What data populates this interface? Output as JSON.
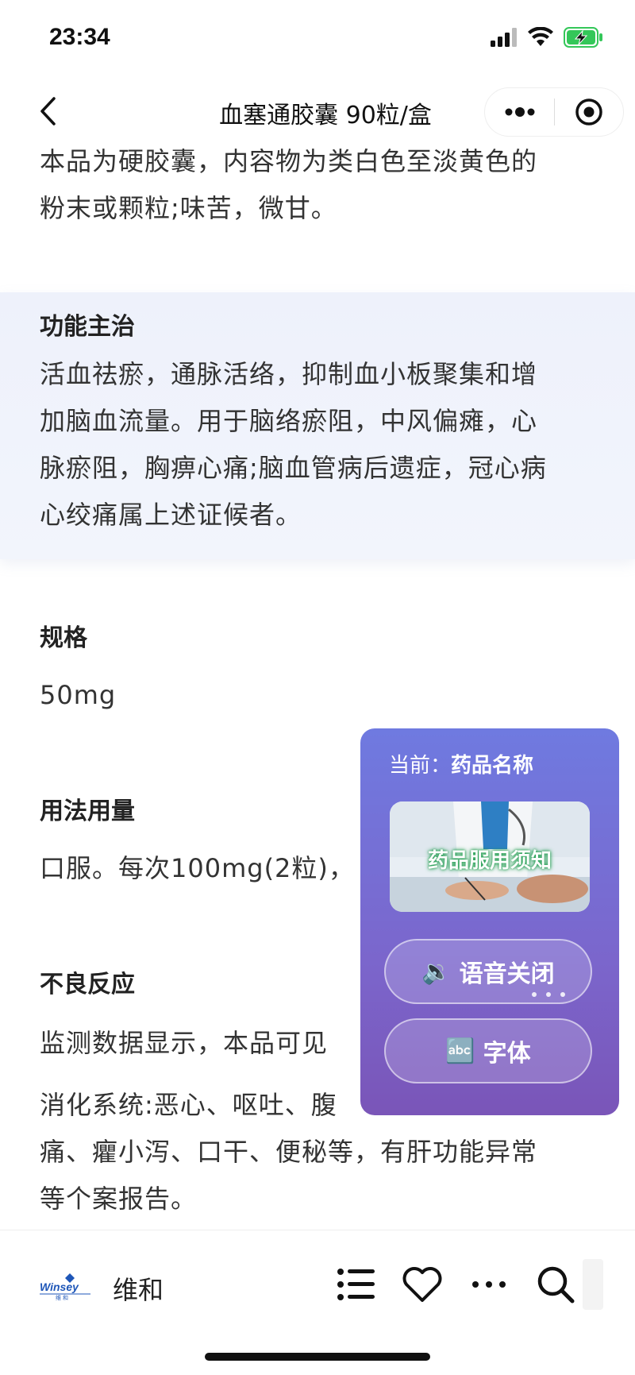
{
  "status_bar": {
    "time": "23:34"
  },
  "nav": {
    "title": "血塞通胶囊 90粒/盒"
  },
  "content": {
    "description_lines": [
      "本品为硬胶囊，内容物为类白色至淡黄色的",
      "粉末或颗粒;味苦，微甘。"
    ],
    "sections": {
      "function": {
        "title": "功能主治",
        "lines": [
          "活血祛瘀，通脉活络，抑制血小板聚集和增",
          "加脑血流量。用于脑络瘀阻，中风偏瘫，心",
          "脉瘀阻，胸痹心痛;脑血管病后遗症，冠心病",
          "心绞痛属上述证候者。"
        ]
      },
      "spec": {
        "title": "规格",
        "value": "50mg"
      },
      "usage": {
        "title": "用法用量",
        "text": "口服。每次100mg(2粒)，"
      },
      "adverse": {
        "title": "不良反应",
        "line1": "监测数据显示，本品可见",
        "lines": [
          "消化系统:恶心、呕吐、腹",
          "痛、癯小泻、口干、便秘等，有肝功能异常",
          "等个案报告。"
        ]
      }
    }
  },
  "float_panel": {
    "current_label": "当前：",
    "current_value": "药品名称",
    "banner_text": "药品服用须知",
    "voice_button": {
      "icon": "🔉",
      "label": "语音关闭"
    },
    "font_button": {
      "icon": "🔤",
      "label": "字体"
    }
  },
  "bottom_bar": {
    "brand_name": "维和",
    "logo_text": "Winsey",
    "logo_sub": "维 和"
  },
  "colors": {
    "panel_gradient_top": "#6f7ae0",
    "panel_gradient_bottom": "#7a55b8",
    "highlight_bg": "#eef1fb",
    "battery_green": "#34c759"
  }
}
